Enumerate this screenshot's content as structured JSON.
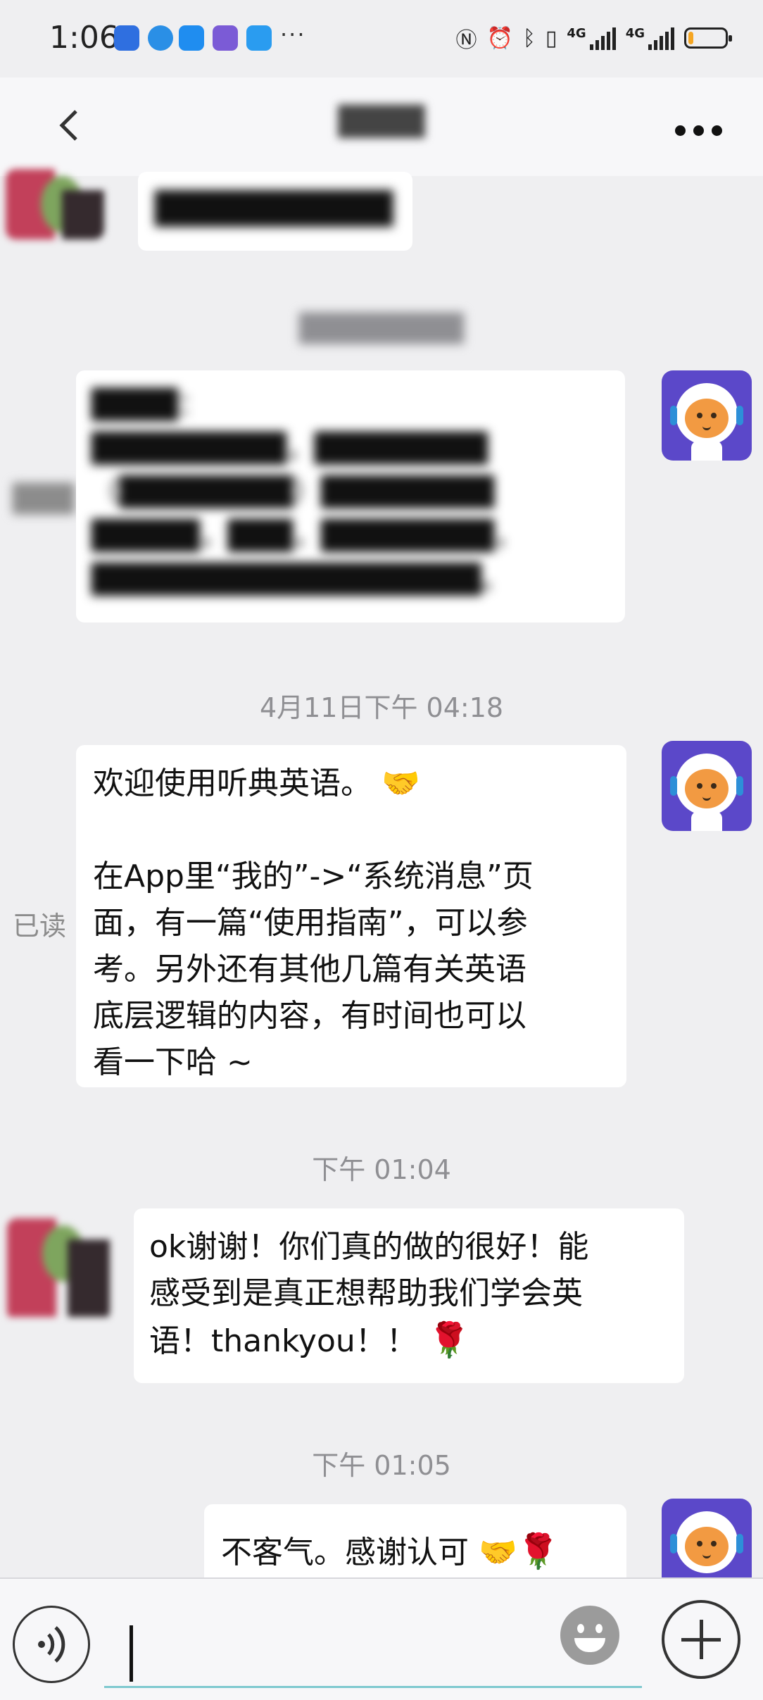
{
  "status_bar": {
    "time": "1:06",
    "more_indicator": "···",
    "network_1": "4G",
    "network_2": "4G",
    "battery_level": 0.12,
    "icons": [
      "nfc-icon",
      "alarm-icon",
      "bluetooth-icon",
      "vibrate-icon"
    ]
  },
  "nav": {
    "title": "████",
    "back_icon": "chevron-left-icon",
    "more_icon": "more-dots-icon"
  },
  "messages": {
    "m1_text": "██████████",
    "time_blurred": "████████",
    "m2_text": "████：\n█████████，████████\n（████████）████████\n█████，███，████████，\n██████████████████。",
    "m2_read_label": "███",
    "time_1": "4月11日下午 04:18",
    "m3_line1": "欢迎使用听典英语。",
    "m3_body": "在App里“我的”->“系统消息”页\n面，有一篇“使用指南”，可以参\n考。另外还有其他几篇有关英语\n底层逻辑的内容，有时间也可以\n看一下哈 ~",
    "m3_read_label": "已读",
    "time_2": "下午 01:04",
    "m4_body": "ok谢谢！你们真的做的很好！能\n感受到是真正想帮助我们学会英\n语！thankyou！！",
    "time_3": "下午 01:05",
    "m5_text": "不客气。感谢认可"
  },
  "input": {
    "value": "",
    "voice_icon": "voice-icon",
    "emoji_icon": "emoji-icon",
    "plus_icon": "plus-icon"
  }
}
